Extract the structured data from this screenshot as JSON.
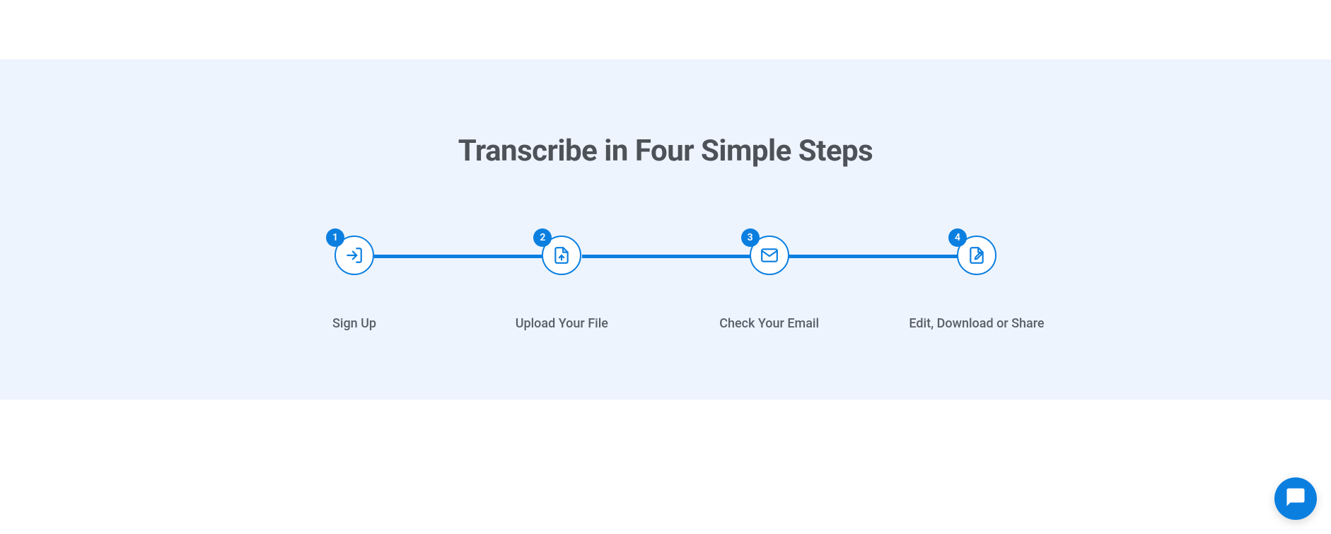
{
  "title": "Transcribe in Four Simple Steps",
  "steps": [
    {
      "number": "1",
      "label": "Sign Up"
    },
    {
      "number": "2",
      "label": "Upload Your File"
    },
    {
      "number": "3",
      "label": "Check Your Email"
    },
    {
      "number": "4",
      "label": "Edit, Download or Share"
    }
  ]
}
